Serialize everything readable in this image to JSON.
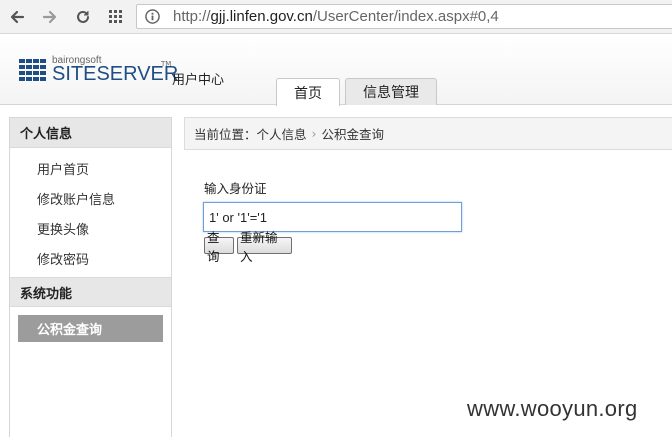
{
  "browser": {
    "url_scheme": "http://",
    "url_host": "gjj.linfen.gov.cn",
    "url_path": "/UserCenter/index.aspx#0,4"
  },
  "header": {
    "brand_small": "bairongsoft",
    "brand": "SITESERVER",
    "tm": "TM",
    "subtitle": "用户中心",
    "tabs": [
      {
        "label": "首页",
        "active": true
      },
      {
        "label": "信息管理",
        "active": false
      }
    ]
  },
  "sidebar": {
    "section1_title": "个人信息",
    "section1_items": [
      "用户首页",
      "修改账户信息",
      "更换头像",
      "修改密码"
    ],
    "section2_title": "系统功能",
    "section2_active": "公积金查询"
  },
  "breadcrumb": {
    "prefix": "当前位置：",
    "parent": "个人信息",
    "current": "公积金查询"
  },
  "form": {
    "label": "输入身份证",
    "input_value": "1' or '1'='1",
    "query_button": "查询",
    "reset_button": "重新输入"
  },
  "watermark": "www.wooyun.org",
  "colors": {
    "brand_blue": "#1f4e86",
    "active_item_bg": "#9c9c9c",
    "input_focus": "#6f9fd4"
  }
}
